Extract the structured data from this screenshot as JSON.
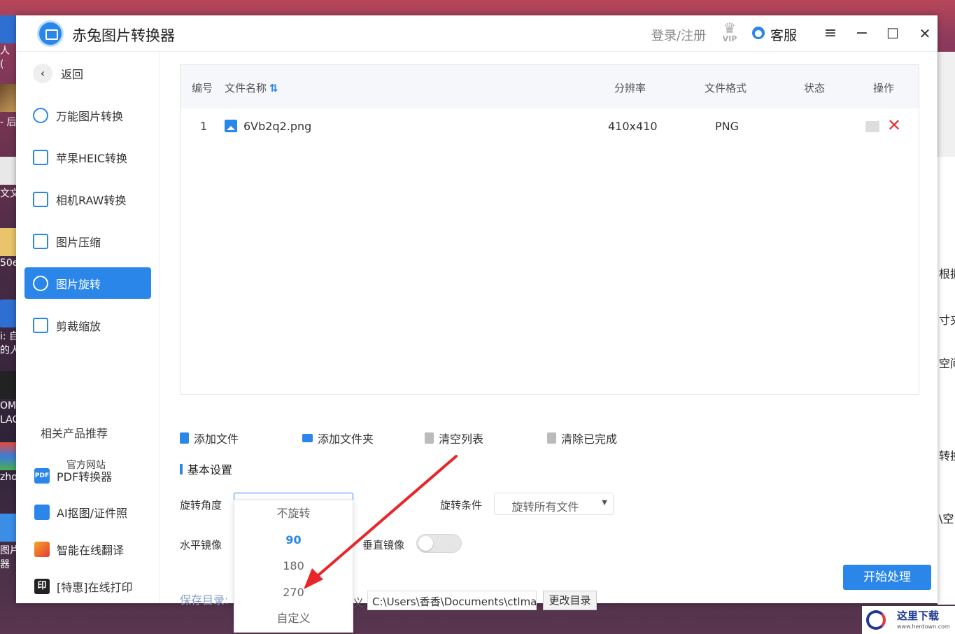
{
  "desktop": {
    "left_labels": [
      "人",
      "(",
      "- 后",
      "文文",
      "50e",
      "i: 自",
      "的人",
      "OM",
      "LAC",
      "zho",
      "图片",
      "器"
    ],
    "right_labels": [
      "根据",
      "寸夹",
      "空间",
      "转换",
      "\\空"
    ]
  },
  "window": {
    "title": "赤兔图片转换器",
    "login_label": "登录/注册",
    "vip_icon": "vip-crown-icon",
    "vip_text": "VIP",
    "service_label": "客服",
    "menu_glyph": "≡",
    "minimize_glyph": "−",
    "maximize_glyph": "☐",
    "close_glyph": "✕"
  },
  "sidebar": {
    "back_label": "返回",
    "back_glyph": "‹",
    "items": [
      {
        "label": "万能图片转换",
        "icon": "convert-icon"
      },
      {
        "label": "苹果HEIC转换",
        "icon": "heic-icon"
      },
      {
        "label": "相机RAW转换",
        "icon": "raw-icon"
      },
      {
        "label": "图片压缩",
        "icon": "compress-icon"
      },
      {
        "label": "图片旋转",
        "icon": "rotate-icon",
        "active": true
      },
      {
        "label": "剪裁缩放",
        "icon": "crop-icon"
      }
    ],
    "recommend_title": "相关产品推荐",
    "official_site": "官方网站",
    "products": [
      {
        "label": "PDF转换器",
        "icon": "pdf-icon",
        "badge": "PDF"
      },
      {
        "label": "AI抠图/证件照",
        "icon": "ai-cutout-icon",
        "badge": ""
      },
      {
        "label": "智能在线翻译",
        "icon": "translate-icon",
        "badge": ""
      },
      {
        "label": "[特惠]在线打印",
        "icon": "print-icon",
        "badge": "印"
      }
    ]
  },
  "table": {
    "headers": {
      "index": "编号",
      "filename": "文件名称",
      "sort_glyph": "⇅",
      "resolution": "分辨率",
      "format": "文件格式",
      "status": "状态",
      "actions": "操作"
    },
    "rows": [
      {
        "index": "1",
        "filename": "6Vb2q2.png",
        "resolution": "410x410",
        "format": "PNG",
        "status": ""
      }
    ],
    "delete_glyph": "✕"
  },
  "actions": {
    "add_file": "添加文件",
    "add_folder": "添加文件夹",
    "clear_list": "清空列表",
    "clear_done": "清除已完成"
  },
  "settings": {
    "title": "基本设置",
    "rotation_angle_label": "旋转角度",
    "rotation_angle_value": "90",
    "rotation_condition_label": "旋转条件",
    "rotation_condition_value": "旋转所有文件",
    "horizontal_mirror_label": "水平镜像",
    "vertical_mirror_label": "垂直镜像",
    "horizontal_mirror_on": false,
    "vertical_mirror_on": false,
    "dropdown_arrow": "▼",
    "angle_options": [
      "不旋转",
      "90",
      "180",
      "270",
      "自定义"
    ],
    "angle_selected": "90"
  },
  "save": {
    "label": "保存目录:",
    "fragment": "义",
    "path": "C:\\Users\\香香\\Documents\\ctlma",
    "change_button": "更改目录"
  },
  "start_button": "开始处理",
  "annotation": {
    "color": "#e8262a"
  },
  "watermark": {
    "text": "这里下载",
    "url": "www.herdown.com"
  },
  "colors": {
    "accent": "#2a86e8",
    "danger": "#e53935"
  }
}
